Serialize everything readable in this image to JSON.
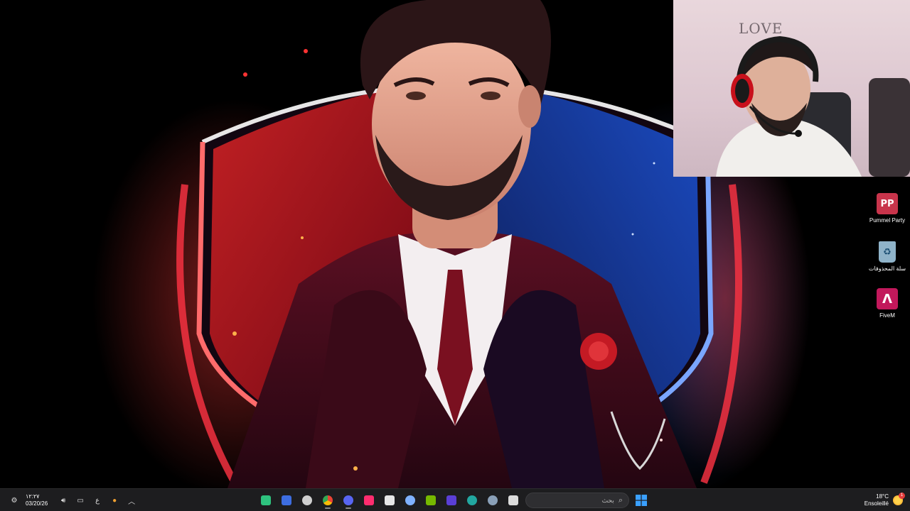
{
  "webcam": {
    "wall_text": "LOVE"
  },
  "desktop_icons": [
    {
      "name": "pummel-party",
      "label": "Pummel Party",
      "glyph": "PP",
      "color": "#c8344b"
    },
    {
      "name": "recycle-bin",
      "label": "سلة المحذوفات",
      "glyph": "♻",
      "color": "#8fb3c9"
    },
    {
      "name": "fivem",
      "label": "FiveM",
      "glyph": "Λ",
      "color": "#c2185b"
    }
  ],
  "taskbar": {
    "clock": {
      "time": "١٢:٢٧",
      "date": "03/20/26"
    },
    "language": "ع",
    "search": {
      "placeholder": "بحث",
      "icon": "search-icon"
    },
    "weather": {
      "temperature": "18°C",
      "condition": "Ensoleillé",
      "icon": "sun-icon",
      "badge": "1"
    },
    "apps": [
      {
        "name": "tradingview",
        "icon": "tv-icon",
        "color": "#2ec27e",
        "active": false
      },
      {
        "name": "notes",
        "icon": "notes-icon",
        "color": "#3d6de0",
        "active": false
      },
      {
        "name": "obs",
        "icon": "obs-icon",
        "color": "#cfcfcf",
        "active": false
      },
      {
        "name": "chrome",
        "icon": "chrome-icon",
        "color": "#f4b400",
        "active": true
      },
      {
        "name": "discord",
        "icon": "discord-icon",
        "color": "#5865f2",
        "active": true
      },
      {
        "name": "tiktok",
        "icon": "tiktok-icon",
        "color": "#ff2d6f",
        "active": false
      },
      {
        "name": "epic-games",
        "icon": "epic-icon",
        "color": "#e6e6e6",
        "active": false
      },
      {
        "name": "steam",
        "icon": "steam-icon",
        "color": "#7fb2ff",
        "active": false
      },
      {
        "name": "nvidia",
        "icon": "nvidia-icon",
        "color": "#76b900",
        "active": false
      },
      {
        "name": "rockstar",
        "icon": "rockstar-icon",
        "color": "#5a3fd6",
        "active": false
      },
      {
        "name": "edge",
        "icon": "edge-icon",
        "color": "#22a7a0",
        "active": false
      },
      {
        "name": "settings",
        "icon": "gear-icon",
        "color": "#8aa0b8",
        "active": false
      },
      {
        "name": "file-explorer",
        "icon": "folder-icon",
        "color": "#dcdcdc",
        "active": false
      }
    ]
  }
}
